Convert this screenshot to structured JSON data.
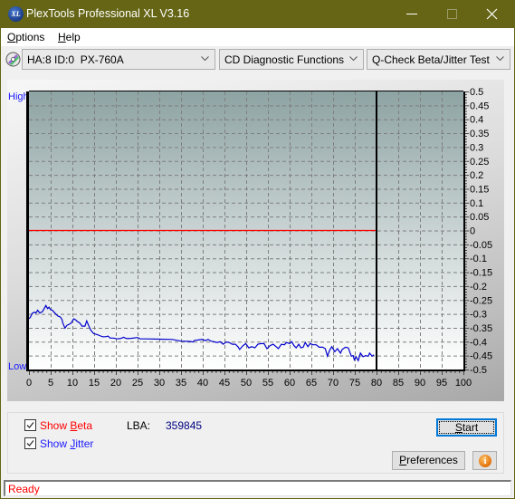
{
  "window": {
    "title": "PlexTools Professional XL V3.16",
    "icon_text": "XL",
    "controls": [
      "minimize",
      "maximize",
      "close"
    ]
  },
  "menu": [
    {
      "key": "O",
      "rest": "ptions"
    },
    {
      "key": "H",
      "rest": "elp"
    }
  ],
  "toolbar": {
    "drive": "HA:8 ID:0  PX-760A",
    "function": "CD Diagnostic Functions",
    "test": "Q-Check Beta/Jitter Test"
  },
  "colors": {
    "titlebar": "#656515",
    "beta": "#ff0000",
    "jitter": "#0000cc",
    "accent": "#0078d7",
    "lba_value": "#000080"
  },
  "chart_data": {
    "type": "line",
    "title": "",
    "xlabel": "",
    "ylabel": "",
    "xlim": [
      0,
      100
    ],
    "ylim": [
      -0.5,
      0.5
    ],
    "grid": true,
    "legend": "none",
    "left_labels": {
      "top": "High",
      "bottom": "Low"
    },
    "x_ticks": [
      0,
      5,
      10,
      15,
      20,
      25,
      30,
      35,
      40,
      45,
      50,
      55,
      60,
      65,
      70,
      75,
      80,
      85,
      90,
      95,
      100
    ],
    "y_ticks": [
      0.5,
      0.45,
      0.4,
      0.35,
      0.3,
      0.25,
      0.2,
      0.15,
      0.1,
      0.05,
      0,
      -0.05,
      -0.1,
      -0.15,
      -0.2,
      -0.25,
      -0.3,
      -0.35,
      -0.4,
      -0.45,
      -0.5
    ],
    "progress_marker_x": 80,
    "series": [
      {
        "name": "Beta",
        "color": "#ff0000",
        "points": [
          [
            0,
            0
          ],
          [
            80,
            0
          ]
        ]
      },
      {
        "name": "Jitter",
        "color": "#0000cc",
        "points": [
          [
            0,
            -0.317
          ],
          [
            0.3,
            -0.313
          ],
          [
            0.8,
            -0.297
          ],
          [
            1.3,
            -0.294
          ],
          [
            1.6,
            -0.297
          ],
          [
            2.0,
            -0.287
          ],
          [
            2.5,
            -0.297
          ],
          [
            3.1,
            -0.292
          ],
          [
            3.4,
            -0.284
          ],
          [
            3.9,
            -0.27
          ],
          [
            4.3,
            -0.281
          ],
          [
            4.6,
            -0.276
          ],
          [
            5.0,
            -0.285
          ],
          [
            5.4,
            -0.287
          ],
          [
            5.8,
            -0.294
          ],
          [
            6.25,
            -0.302
          ],
          [
            6.7,
            -0.308
          ],
          [
            7.2,
            -0.311
          ],
          [
            7.6,
            -0.32
          ],
          [
            7.8,
            -0.333
          ],
          [
            8.3,
            -0.351
          ],
          [
            8.75,
            -0.341
          ],
          [
            9.3,
            -0.337
          ],
          [
            9.7,
            -0.333
          ],
          [
            10.3,
            -0.318
          ],
          [
            10.8,
            -0.322
          ],
          [
            11.1,
            -0.327
          ],
          [
            11.7,
            -0.333
          ],
          [
            12.2,
            -0.344
          ],
          [
            12.9,
            -0.344
          ],
          [
            13.3,
            -0.325
          ],
          [
            13.8,
            -0.344
          ],
          [
            14.3,
            -0.36
          ],
          [
            14.9,
            -0.371
          ],
          [
            15.6,
            -0.374
          ],
          [
            16.25,
            -0.378
          ],
          [
            16.9,
            -0.382
          ],
          [
            17.6,
            -0.382
          ],
          [
            18.2,
            -0.38
          ],
          [
            18.7,
            -0.387
          ],
          [
            19.4,
            -0.387
          ],
          [
            20.3,
            -0.39
          ],
          [
            21.0,
            -0.389
          ],
          [
            21.8,
            -0.384
          ],
          [
            22.5,
            -0.389
          ],
          [
            23.5,
            -0.388
          ],
          [
            25.0,
            -0.385
          ],
          [
            25.6,
            -0.39
          ],
          [
            27,
            -0.39
          ],
          [
            30,
            -0.391
          ],
          [
            33,
            -0.392
          ],
          [
            35,
            -0.398
          ],
          [
            37,
            -0.399
          ],
          [
            37.8,
            -0.401
          ],
          [
            38.1,
            -0.395
          ],
          [
            38.8,
            -0.394
          ],
          [
            39.9,
            -0.392
          ],
          [
            40.6,
            -0.396
          ],
          [
            41.25,
            -0.392
          ],
          [
            41.9,
            -0.398
          ],
          [
            42.6,
            -0.4
          ],
          [
            43.3,
            -0.403
          ],
          [
            44,
            -0.4
          ],
          [
            44.7,
            -0.409
          ],
          [
            45.4,
            -0.401
          ],
          [
            46.1,
            -0.403
          ],
          [
            46.8,
            -0.409
          ],
          [
            47.5,
            -0.409
          ],
          [
            48.1,
            -0.418
          ],
          [
            48.5,
            -0.428
          ],
          [
            49.2,
            -0.415
          ],
          [
            49.9,
            -0.407
          ],
          [
            50.6,
            -0.422
          ],
          [
            51.3,
            -0.418
          ],
          [
            52,
            -0.422
          ],
          [
            52.7,
            -0.409
          ],
          [
            53.4,
            -0.407
          ],
          [
            54.1,
            -0.407
          ],
          [
            54.8,
            -0.425
          ],
          [
            55.5,
            -0.414
          ],
          [
            56.2,
            -0.409
          ],
          [
            56.9,
            -0.418
          ],
          [
            57.4,
            -0.425
          ],
          [
            58.1,
            -0.409
          ],
          [
            58.8,
            -0.411
          ],
          [
            59.3,
            -0.403
          ],
          [
            60,
            -0.407
          ],
          [
            60.5,
            -0.4
          ],
          [
            61,
            -0.414
          ],
          [
            61.5,
            -0.422
          ],
          [
            62.1,
            -0.409
          ],
          [
            62.6,
            -0.422
          ],
          [
            63.1,
            -0.42
          ],
          [
            63.6,
            -0.403
          ],
          [
            64.2,
            -0.418
          ],
          [
            64.7,
            -0.407
          ],
          [
            65.4,
            -0.411
          ],
          [
            66.1,
            -0.411
          ],
          [
            66.8,
            -0.42
          ],
          [
            67.6,
            -0.42
          ],
          [
            68.2,
            -0.425
          ],
          [
            68.7,
            -0.452
          ],
          [
            69.2,
            -0.431
          ],
          [
            69.7,
            -0.418
          ],
          [
            70.4,
            -0.436
          ],
          [
            71,
            -0.425
          ],
          [
            71.7,
            -0.441
          ],
          [
            72.1,
            -0.428
          ],
          [
            72.85,
            -0.42
          ],
          [
            73.5,
            -0.422
          ],
          [
            74.2,
            -0.452
          ],
          [
            74.6,
            -0.45
          ],
          [
            74.9,
            -0.465
          ],
          [
            75.3,
            -0.454
          ],
          [
            75.8,
            -0.468
          ],
          [
            76.3,
            -0.441
          ],
          [
            76.9,
            -0.454
          ],
          [
            77.5,
            -0.45
          ],
          [
            78.1,
            -0.452
          ],
          [
            78.4,
            -0.441
          ],
          [
            79,
            -0.452
          ],
          [
            79.4,
            -0.447
          ]
        ]
      }
    ]
  },
  "controls": {
    "show_beta": {
      "prefix": "Show ",
      "key": "B",
      "rest": "eta",
      "checked": true
    },
    "show_jitter": {
      "prefix": "Show ",
      "key": "J",
      "rest": "itter",
      "checked": true
    },
    "lba_label": "LBA:",
    "lba_value": "359845",
    "start": {
      "key": "S",
      "rest": "tart"
    },
    "preferences": {
      "key": "P",
      "rest": "references"
    },
    "info_glyph": "i"
  },
  "status": {
    "text": "Ready"
  }
}
